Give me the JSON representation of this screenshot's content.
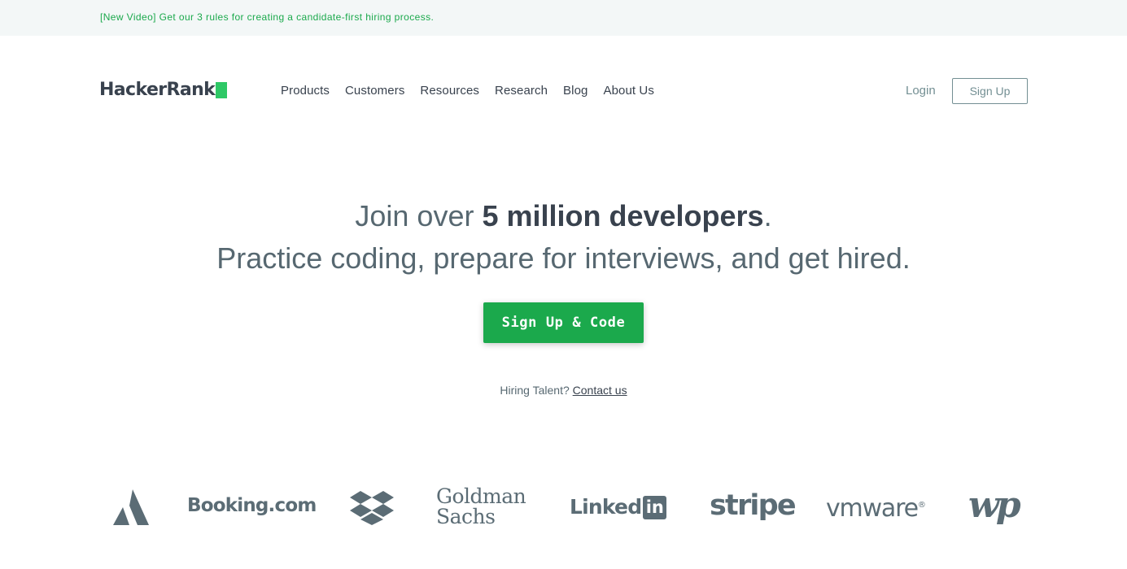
{
  "announcement": {
    "text": "[New Video] Get our 3 rules for creating a candidate-first hiring process."
  },
  "header": {
    "logo_text": "HackerRank",
    "nav": [
      "Products",
      "Customers",
      "Resources",
      "Research",
      "Blog",
      "About Us"
    ],
    "login_label": "Login",
    "signup_label": "Sign Up"
  },
  "hero": {
    "line1_prefix": "Join over ",
    "line1_bold": "5 million developers",
    "line1_suffix": ".",
    "line2": "Practice coding, prepare for interviews, and get hired.",
    "cta_label": "Sign Up & Code",
    "hiring_prefix": "Hiring Talent? ",
    "hiring_link": "Contact us"
  },
  "customers": {
    "booking": "Booking.com",
    "gs_line1": "Goldman",
    "gs_line2": "Sachs",
    "linkedin_text": "Linked",
    "linkedin_box": "in",
    "stripe": "stripe",
    "vmware": "vmware",
    "vmware_mark": "®",
    "wp": "wp"
  },
  "colors": {
    "brand_green": "#1ba94c",
    "logo_green": "#2ec866",
    "text_dark": "#39424e",
    "text_muted": "#576871",
    "banner_bg": "#f3f7f7",
    "logo_gray": "#5b6c75"
  },
  "icons": [
    "atlassian-logo-icon",
    "dropbox-logo-icon"
  ]
}
